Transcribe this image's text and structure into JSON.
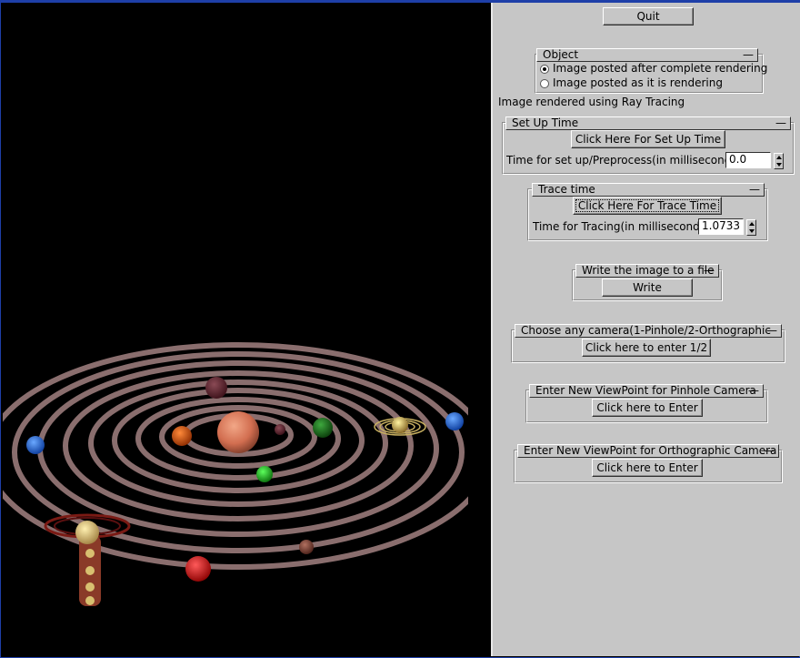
{
  "quit_label": "Quit",
  "object_group": {
    "title": "Object",
    "collapse_glyph": "—",
    "options": [
      {
        "label": "Image posted after complete rendering",
        "selected": true
      },
      {
        "label": "Image posted as it is rendering",
        "selected": false
      }
    ]
  },
  "status_text": "Image rendered using Ray Tracing",
  "setup_time": {
    "title": "Set Up Time",
    "collapse_glyph": "—",
    "button": "Click Here For Set Up Time",
    "label": "Time for set up/Preprocess(in milliseconds)",
    "value": "0.0"
  },
  "trace_time": {
    "title": "Trace time",
    "collapse_glyph": "—",
    "button": "Click Here For Trace Time",
    "label": "Time for Tracing(in milliseconds)",
    "value": "1.0733"
  },
  "write_group": {
    "title": "Write the image to a file",
    "collapse_glyph": "—",
    "button": "Write"
  },
  "camera_group": {
    "title": "Choose any camera(1-Pinhole/2-Orthographic",
    "collapse_glyph": "—",
    "button": "Click here to enter 1/2"
  },
  "pinhole_group": {
    "title": "Enter New ViewPoint for Pinhole Camera",
    "collapse_glyph": "—",
    "button": "Click here to Enter"
  },
  "ortho_group": {
    "title": "Enter New ViewPoint for Orthographic Camera",
    "collapse_glyph": "—",
    "button": "Click here to Enter"
  },
  "colors": {
    "window_border": "#1e3fa8",
    "panel_bg": "#c6c6c6",
    "canvas_bg": "#000000",
    "orbit_ring": "#8a6e6e"
  }
}
